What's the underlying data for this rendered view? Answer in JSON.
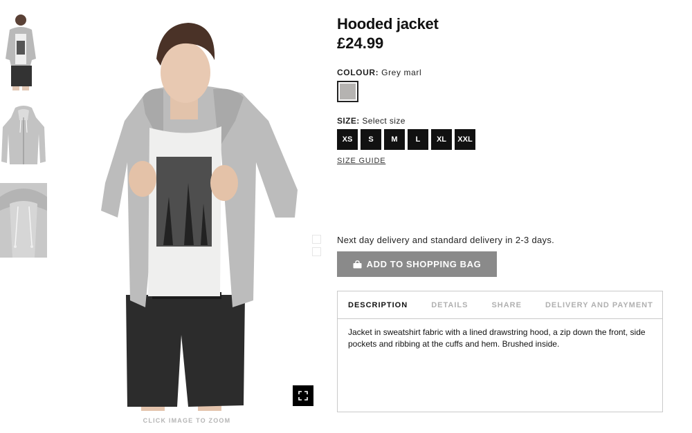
{
  "product": {
    "title": "Hooded jacket",
    "price": "£24.99"
  },
  "colour": {
    "label": "COLOUR:",
    "value": "Grey marl",
    "swatch_color": "#b5b3b1"
  },
  "size": {
    "label": "SIZE:",
    "value": "Select size",
    "options": [
      "XS",
      "S",
      "M",
      "L",
      "XL",
      "XXL"
    ],
    "guide_label": "SIZE GUIDE"
  },
  "delivery": {
    "note": "Next day delivery and standard delivery in 2-3 days."
  },
  "cart": {
    "add_label": "ADD TO SHOPPING BAG",
    "button_color": "#8a8a8a"
  },
  "tabs": {
    "items": [
      {
        "label": "DESCRIPTION",
        "active": true
      },
      {
        "label": "DETAILS",
        "active": false
      },
      {
        "label": "SHARE",
        "active": false
      },
      {
        "label": "DELIVERY AND PAYMENT",
        "active": false
      }
    ],
    "description": "Jacket in sweatshirt fabric with a lined drawstring hood, a zip down the front, side pockets and ribbing at the cuffs and hem. Brushed inside."
  },
  "gallery": {
    "zoom_hint": "CLICK IMAGE TO ZOOM",
    "zoom_icon": "expand-icon",
    "thumbnails": [
      "thumb-model-front",
      "thumb-jacket-front",
      "thumb-hood-detail"
    ]
  }
}
